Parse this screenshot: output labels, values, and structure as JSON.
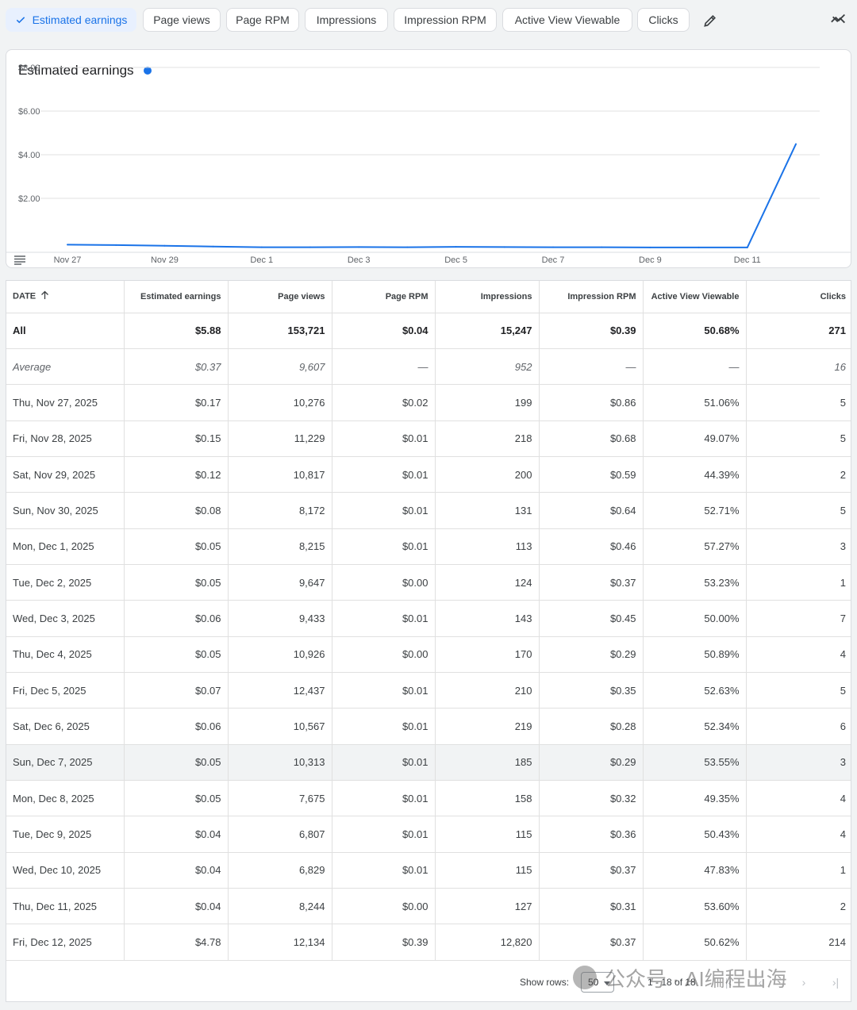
{
  "metrics": {
    "chips": [
      {
        "label": "Estimated earnings",
        "selected": true
      },
      {
        "label": "Page views",
        "selected": false
      },
      {
        "label": "Page RPM",
        "selected": false
      },
      {
        "label": "Impressions",
        "selected": false
      },
      {
        "label": "Impression RPM",
        "selected": false
      },
      {
        "label": "Active View Viewable",
        "selected": false
      },
      {
        "label": "Clicks",
        "selected": false
      }
    ],
    "edit_icon": "pencil-icon",
    "compare_icon": "trend-compare-icon"
  },
  "colors": {
    "accent": "#1a73e8",
    "series_line": "#1a73e8",
    "chip_selected_bg": "#e8f0fe"
  },
  "chart_data": {
    "type": "line",
    "title": "Estimated earnings",
    "xlabel": "",
    "ylabel": "",
    "x": [
      "Nov 27",
      "Nov 28",
      "Nov 29",
      "Nov 30",
      "Dec 1",
      "Dec 2",
      "Dec 3",
      "Dec 4",
      "Dec 5",
      "Dec 6",
      "Dec 7",
      "Dec 8",
      "Dec 9",
      "Dec 10",
      "Dec 11",
      "Dec 12"
    ],
    "x_tick_labels": [
      "Nov 27",
      "Nov 29",
      "Dec 1",
      "Dec 3",
      "Dec 5",
      "Dec 7",
      "Dec 9",
      "Dec 11"
    ],
    "series": [
      {
        "values": [
          0.17,
          0.15,
          0.12,
          0.08,
          0.05,
          0.05,
          0.06,
          0.05,
          0.07,
          0.06,
          0.05,
          0.05,
          0.04,
          0.04,
          0.04,
          4.78
        ]
      }
    ],
    "y_tick_labels": [
      "$2.00",
      "$4.00",
      "$6.00",
      "$8.00"
    ],
    "y_ticks": [
      2,
      4,
      6,
      8
    ],
    "ylim": [
      0,
      8
    ],
    "grid": true,
    "legend": "none"
  },
  "table": {
    "headers": [
      "DATE",
      "Estimated earnings",
      "Page views",
      "Page RPM",
      "Impressions",
      "Impression RPM",
      "Active View Viewable",
      "Clicks"
    ],
    "all": [
      "All",
      "$5.88",
      "153,721",
      "$0.04",
      "15,247",
      "$0.39",
      "50.68%",
      "271"
    ],
    "average": [
      "Average",
      "$0.37",
      "9,607",
      "—",
      "952",
      "—",
      "—",
      "16"
    ],
    "rows": [
      [
        "Thu, Nov 27, 2025",
        "$0.17",
        "10,276",
        "$0.02",
        "199",
        "$0.86",
        "51.06%",
        "5"
      ],
      [
        "Fri, Nov 28, 2025",
        "$0.15",
        "11,229",
        "$0.01",
        "218",
        "$0.68",
        "49.07%",
        "5"
      ],
      [
        "Sat, Nov 29, 2025",
        "$0.12",
        "10,817",
        "$0.01",
        "200",
        "$0.59",
        "44.39%",
        "2"
      ],
      [
        "Sun, Nov 30, 2025",
        "$0.08",
        "8,172",
        "$0.01",
        "131",
        "$0.64",
        "52.71%",
        "5"
      ],
      [
        "Mon, Dec 1, 2025",
        "$0.05",
        "8,215",
        "$0.01",
        "113",
        "$0.46",
        "57.27%",
        "3"
      ],
      [
        "Tue, Dec 2, 2025",
        "$0.05",
        "9,647",
        "$0.00",
        "124",
        "$0.37",
        "53.23%",
        "1"
      ],
      [
        "Wed, Dec 3, 2025",
        "$0.06",
        "9,433",
        "$0.01",
        "143",
        "$0.45",
        "50.00%",
        "7"
      ],
      [
        "Thu, Dec 4, 2025",
        "$0.05",
        "10,926",
        "$0.00",
        "170",
        "$0.29",
        "50.89%",
        "4"
      ],
      [
        "Fri, Dec 5, 2025",
        "$0.07",
        "12,437",
        "$0.01",
        "210",
        "$0.35",
        "52.63%",
        "5"
      ],
      [
        "Sat, Dec 6, 2025",
        "$0.06",
        "10,567",
        "$0.01",
        "219",
        "$0.28",
        "52.34%",
        "6"
      ],
      [
        "Sun, Dec 7, 2025",
        "$0.05",
        "10,313",
        "$0.01",
        "185",
        "$0.29",
        "53.55%",
        "3"
      ],
      [
        "Mon, Dec 8, 2025",
        "$0.05",
        "7,675",
        "$0.01",
        "158",
        "$0.32",
        "49.35%",
        "4"
      ],
      [
        "Tue, Dec 9, 2025",
        "$0.04",
        "6,807",
        "$0.01",
        "115",
        "$0.36",
        "50.43%",
        "4"
      ],
      [
        "Wed, Dec 10, 2025",
        "$0.04",
        "6,829",
        "$0.01",
        "115",
        "$0.37",
        "47.83%",
        "1"
      ],
      [
        "Thu, Dec 11, 2025",
        "$0.04",
        "8,244",
        "$0.00",
        "127",
        "$0.31",
        "53.60%",
        "2"
      ],
      [
        "Fri, Dec 12, 2025",
        "$4.78",
        "12,134",
        "$0.39",
        "12,820",
        "$0.37",
        "50.62%",
        "214"
      ]
    ]
  },
  "footer": {
    "show_rows_label": "Show rows:",
    "rows_per_page": "50",
    "range_text": "1 - 18 of 18"
  },
  "watermark": "公众号 · AI编程出海"
}
